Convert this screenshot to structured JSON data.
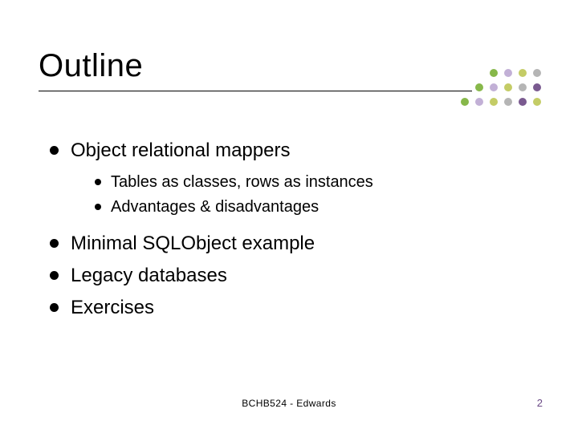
{
  "slide": {
    "title": "Outline",
    "bullets": [
      {
        "text": "Object relational mappers",
        "children": [
          {
            "text": "Tables as classes, rows as instances"
          },
          {
            "text": "Advantages & disadvantages"
          }
        ]
      },
      {
        "text": "Minimal SQLObject example"
      },
      {
        "text": "Legacy databases"
      },
      {
        "text": "Exercises"
      }
    ],
    "footer_center": "BCHB524 - Edwards",
    "page_number": "2"
  },
  "decor": {
    "dot_classes": [
      "d-blank",
      "d-blank",
      "d-green",
      "d-lav",
      "d-olive",
      "d-grey",
      "d-blank",
      "d-green",
      "d-lav",
      "d-olive",
      "d-grey",
      "d-plum",
      "d-green",
      "d-lav",
      "d-olive",
      "d-grey",
      "d-plum",
      "d-olive"
    ]
  }
}
